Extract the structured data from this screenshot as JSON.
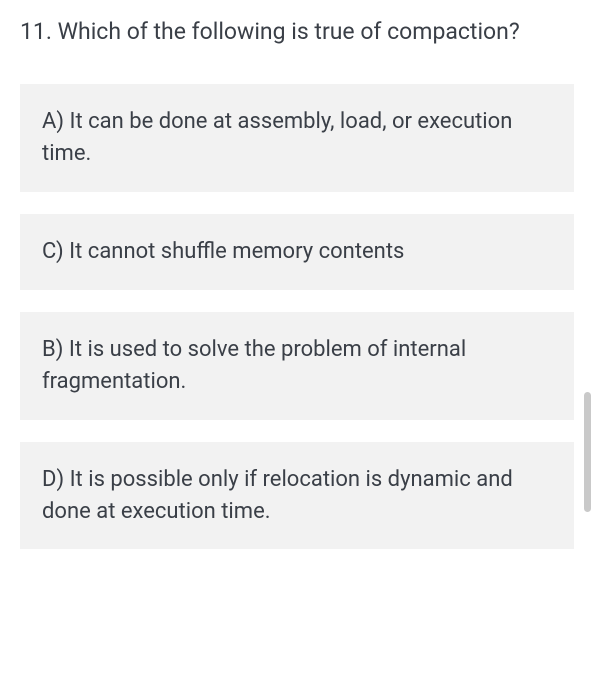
{
  "question": {
    "number": "11.",
    "text": "Which of the following is true of compaction?"
  },
  "options": [
    {
      "label": "A)",
      "text": "It can be done at assembly, load, or execution time."
    },
    {
      "label": "C)",
      "text": "It cannot shuffle memory contents"
    },
    {
      "label": "B)",
      "text": "It is used to solve the problem of internal fragmentation."
    },
    {
      "label": "D)",
      "text": "It is possible only if relocation is dynamic and done at execution time."
    }
  ]
}
